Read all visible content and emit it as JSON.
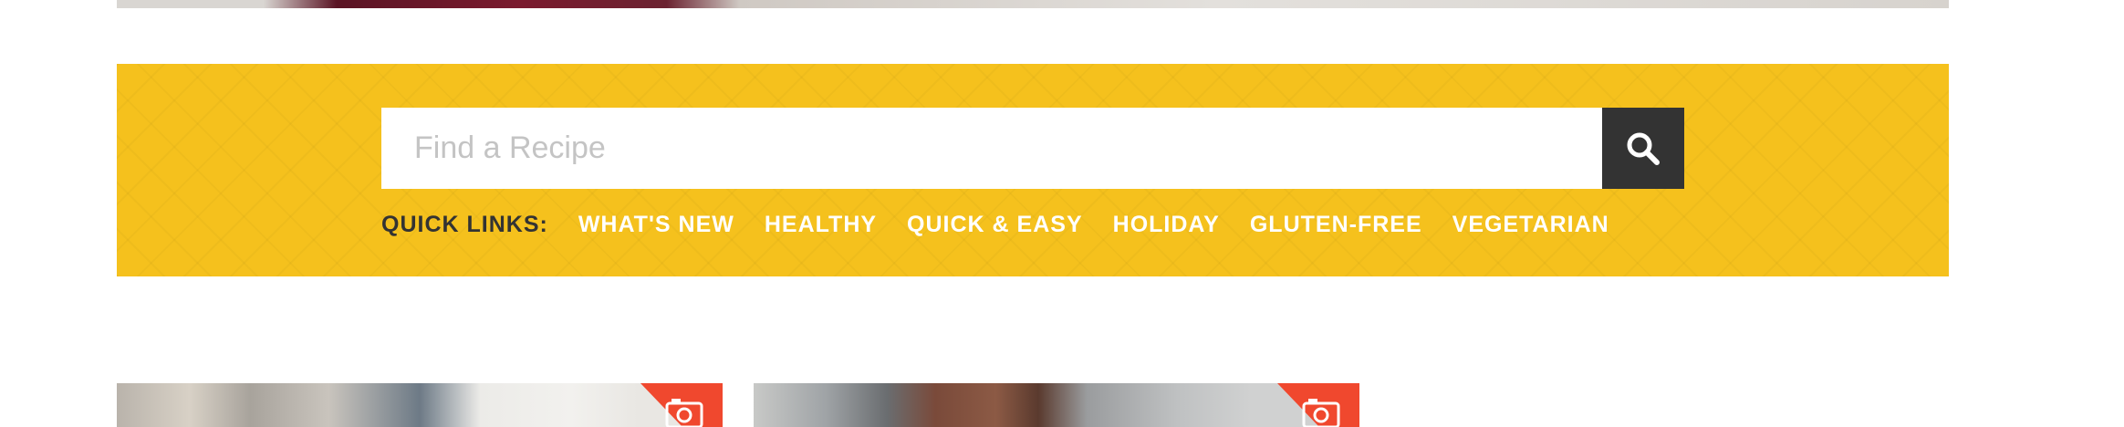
{
  "search": {
    "placeholder": "Find a Recipe",
    "button_icon": "search-icon"
  },
  "quick_links": {
    "label": "QUICK LINKS:",
    "items": [
      {
        "label": "WHAT'S NEW"
      },
      {
        "label": "HEALTHY"
      },
      {
        "label": "QUICK & EASY"
      },
      {
        "label": "HOLIDAY"
      },
      {
        "label": "GLUTEN-FREE"
      },
      {
        "label": "VEGETARIAN"
      }
    ]
  },
  "cards": [
    {
      "badge_icon": "camera-icon"
    },
    {
      "badge_icon": "camera-icon"
    }
  ],
  "colors": {
    "band": "#f5c11d",
    "search_button": "#333333",
    "quick_link_text": "#ffffff",
    "quick_label_text": "#333333",
    "card_badge": "#f0482e"
  }
}
